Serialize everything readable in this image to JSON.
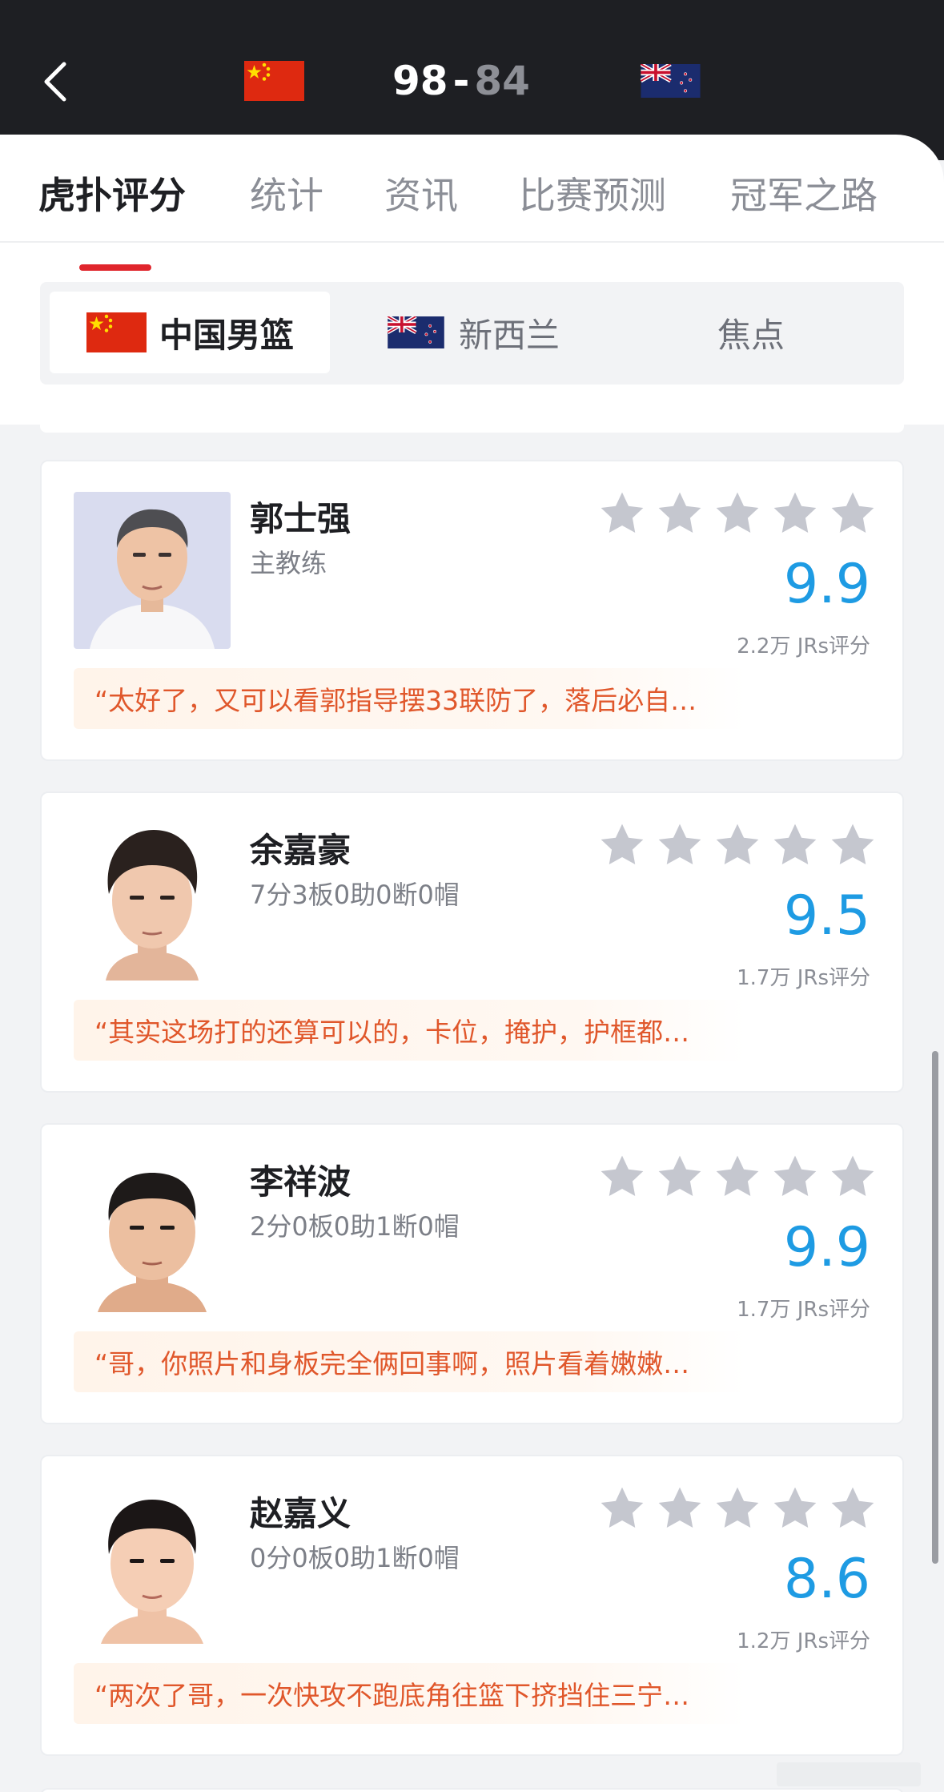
{
  "header": {
    "home_score": "98",
    "separator": "-",
    "away_score": "84",
    "home_flag_icon": "flag-china",
    "away_flag_icon": "flag-new-zealand",
    "back_icon": "chevron-left-icon"
  },
  "tabs": [
    {
      "label": "虎扑评分",
      "active": true
    },
    {
      "label": "统计",
      "active": false
    },
    {
      "label": "资讯",
      "active": false
    },
    {
      "label": "比赛预测",
      "active": false
    },
    {
      "label": "冠军之路",
      "active": false
    }
  ],
  "team_segments": [
    {
      "label": "中国男篮",
      "active": true
    },
    {
      "label": "新西兰",
      "active": false
    },
    {
      "label": "焦点",
      "active": false
    }
  ],
  "players": [
    {
      "name": "郭士强",
      "subline": "主教练",
      "rating": "9.9",
      "votes": "2.2万 JRs评分",
      "comment": "“太好了，又可以看郭指导摆33联防了，落后必自…",
      "stars_filled": 0
    },
    {
      "name": "余嘉豪",
      "subline": "7分3板0助0断0帽",
      "rating": "9.5",
      "votes": "1.7万 JRs评分",
      "comment": "“其实这场打的还算可以的，卡位，掩护，护框都…",
      "stars_filled": 0
    },
    {
      "name": "李祥波",
      "subline": "2分0板0助1断0帽",
      "rating": "9.9",
      "votes": "1.7万 JRs评分",
      "comment": "“哥，你照片和身板完全俩回事啊，照片看着嫩嫩…",
      "stars_filled": 0
    },
    {
      "name": "赵嘉义",
      "subline": "0分0板0助1断0帽",
      "rating": "8.6",
      "votes": "1.2万 JRs评分",
      "comment": "“两次了哥，一次快攻不跑底角往篮下挤挡住三宁…",
      "stars_filled": 0
    }
  ],
  "colors": {
    "header_bg": "#1e1f23",
    "accent_red": "#e0252c",
    "rating_blue": "#1e9be3",
    "comment_orange": "#e0572b",
    "star_gray": "#c5c7cf"
  }
}
